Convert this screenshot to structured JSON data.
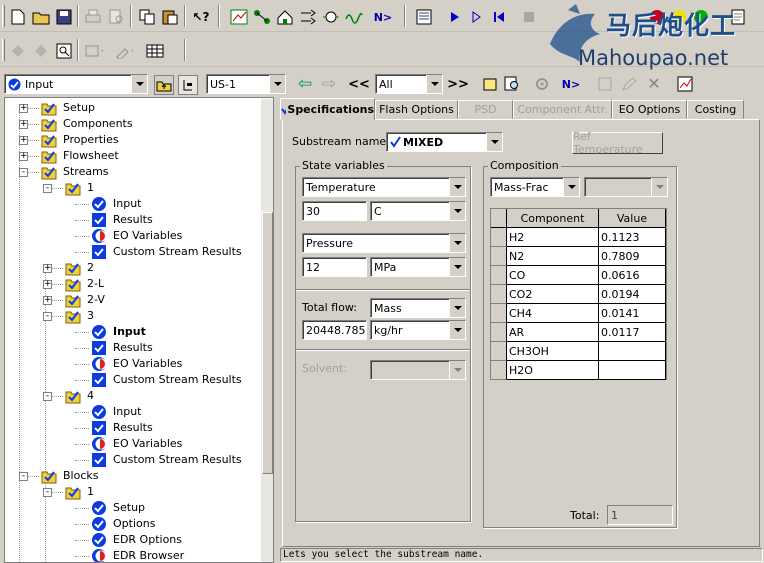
{
  "toolbar": {
    "nav_combo_value": "Input",
    "unit_set_value": "US-1",
    "filter_value": "All",
    "next_label": "N>",
    "prev_prev": "<<",
    "next_next": ">>"
  },
  "watermark": {
    "text_cn": "马后炮化工",
    "url": "Mahoupao.net"
  },
  "tree": {
    "nodes": [
      {
        "label": "Setup"
      },
      {
        "label": "Components"
      },
      {
        "label": "Properties"
      },
      {
        "label": "Flowsheet"
      },
      {
        "label": "Streams"
      },
      {
        "label": "1"
      },
      {
        "label": "Input"
      },
      {
        "label": "Results"
      },
      {
        "label": "EO Variables"
      },
      {
        "label": "Custom Stream Results"
      },
      {
        "label": "2"
      },
      {
        "label": "2-L"
      },
      {
        "label": "2-V"
      },
      {
        "label": "3"
      },
      {
        "label": "Input"
      },
      {
        "label": "Results"
      },
      {
        "label": "EO Variables"
      },
      {
        "label": "Custom Stream Results"
      },
      {
        "label": "4"
      },
      {
        "label": "Input"
      },
      {
        "label": "Results"
      },
      {
        "label": "EO Variables"
      },
      {
        "label": "Custom Stream Results"
      },
      {
        "label": "Blocks"
      },
      {
        "label": "1"
      },
      {
        "label": "Setup"
      },
      {
        "label": "Options"
      },
      {
        "label": "EDR Options"
      },
      {
        "label": "EDR Browser"
      }
    ]
  },
  "tabs": [
    {
      "label": "Specifications"
    },
    {
      "label": "Flash Options"
    },
    {
      "label": "PSD"
    },
    {
      "label": "Component Attr."
    },
    {
      "label": "EO Options"
    },
    {
      "label": "Costing"
    }
  ],
  "spec": {
    "substream_label": "Substream name:",
    "substream_value": "MIXED",
    "ref_temp_button": "Ref Temperature",
    "state_vars_label": "State variables",
    "var1_name": "Temperature",
    "var1_value": "30",
    "var1_unit": "C",
    "var2_name": "Pressure",
    "var2_value": "12",
    "var2_unit": "MPa",
    "total_flow_label": "Total flow:",
    "total_flow_basis": "Mass",
    "total_flow_value": "20448.785",
    "total_flow_unit": "kg/hr",
    "solvent_label": "Solvent:",
    "composition_label": "Composition",
    "composition_basis": "Mass-Frac",
    "grid_headers": {
      "component": "Component",
      "value": "Value"
    },
    "components": [
      {
        "name": "H2",
        "value": "0.1123"
      },
      {
        "name": "N2",
        "value": "0.7809"
      },
      {
        "name": "CO",
        "value": "0.0616"
      },
      {
        "name": "CO2",
        "value": "0.0194"
      },
      {
        "name": "CH4",
        "value": "0.0141"
      },
      {
        "name": "AR",
        "value": "0.0117"
      },
      {
        "name": "CH3OH",
        "value": ""
      },
      {
        "name": "H2O",
        "value": ""
      }
    ],
    "total_label": "Total:",
    "total_value": "1"
  },
  "status": {
    "message": "Lets you select the substream name."
  },
  "colors": {
    "window_bg": "#d4d0c8",
    "check_blue": "#0b3ce0",
    "folder_yellow": "#f0d040",
    "watermark_blue": "#1e4f8c"
  }
}
